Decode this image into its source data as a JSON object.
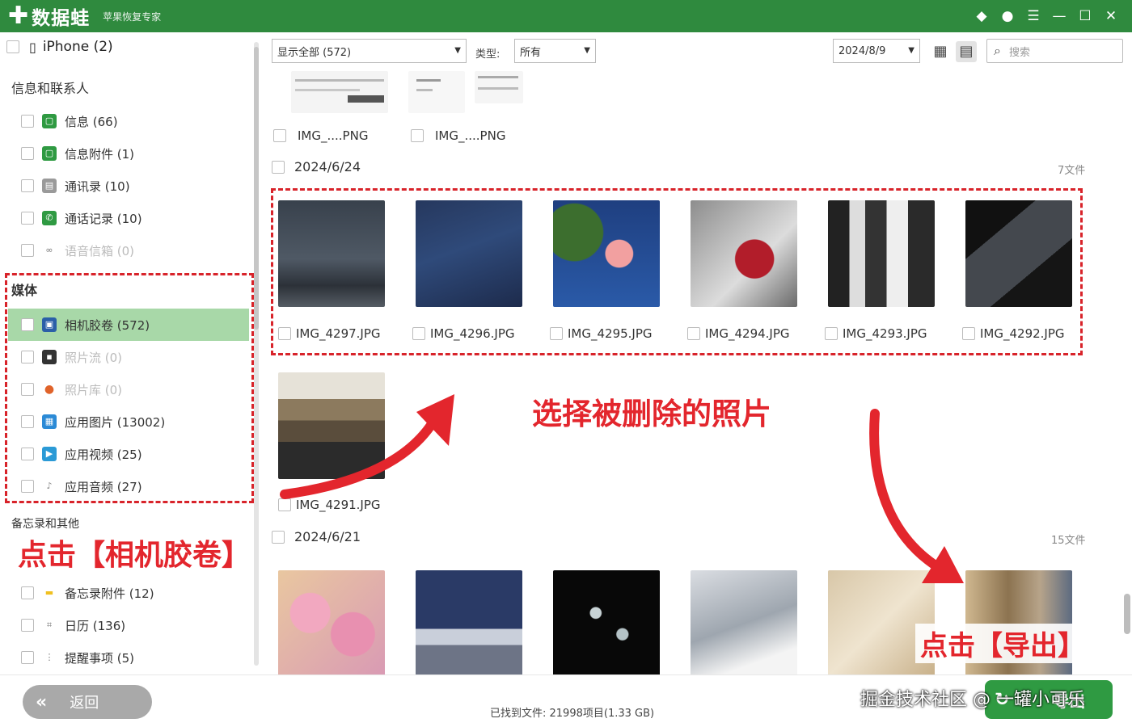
{
  "app": {
    "name": "数据蛙",
    "slogan": "苹果恢复专家"
  },
  "window_controls": [
    "gem-icon",
    "chat-icon",
    "menu-icon",
    "minimize-icon",
    "maximize-icon",
    "close-icon"
  ],
  "sidebar": {
    "device": "iPhone (2)",
    "sections": [
      {
        "title": "信息和联系人",
        "items": [
          {
            "label": "信息 (66)",
            "icon": "message-icon",
            "color": "#2f9a42"
          },
          {
            "label": "信息附件 (1)",
            "icon": "message-attachment-icon",
            "color": "#2f9a42"
          },
          {
            "label": "通讯录 (10)",
            "icon": "contacts-icon",
            "color": "#9a9a9a"
          },
          {
            "label": "通话记录 (10)",
            "icon": "phone-icon",
            "color": "#2f9a42"
          },
          {
            "label": "语音信箱 (0)",
            "icon": "voicemail-icon",
            "color": "#777777"
          }
        ]
      },
      {
        "title": "媒体",
        "items": [
          {
            "label": "相机胶卷 (572)",
            "icon": "camera-roll-icon",
            "color": "#2b5fa8",
            "selected": true
          },
          {
            "label": "照片流 (0)",
            "icon": "photo-stream-icon",
            "color": "#333333"
          },
          {
            "label": "照片库 (0)",
            "icon": "photo-library-icon",
            "color": "#e0632a"
          },
          {
            "label": "应用图片 (13002)",
            "icon": "app-photo-icon",
            "color": "#2b8ad6"
          },
          {
            "label": "应用视频 (25)",
            "icon": "app-video-icon",
            "color": "#2b9ad6"
          },
          {
            "label": "应用音频 (27)",
            "icon": "app-audio-icon",
            "color": "#888888"
          }
        ]
      },
      {
        "title": "备忘录和其他",
        "items": [
          {
            "label": "备忘录附件 (12)",
            "icon": "note-attachment-icon",
            "color": "#f0c020"
          },
          {
            "label": "日历 (136)",
            "icon": "calendar-icon",
            "color": "#777777"
          },
          {
            "label": "提醒事项 (5)",
            "icon": "reminder-icon",
            "color": "#777777"
          }
        ]
      }
    ]
  },
  "toolbar": {
    "filter_select": "显示全部 (572)",
    "type_label": "类型:",
    "type_select": "所有",
    "date_select": "2024/8/9",
    "search_placeholder": "搜索"
  },
  "top_captions": [
    "IMG_....PNG",
    "IMG_....PNG"
  ],
  "groups": [
    {
      "date": "2024/6/24",
      "count": "7文件",
      "photos": [
        {
          "name": "IMG_4297.JPG"
        },
        {
          "name": "IMG_4296.JPG"
        },
        {
          "name": "IMG_4295.JPG"
        },
        {
          "name": "IMG_4294.JPG"
        },
        {
          "name": "IMG_4293.JPG"
        },
        {
          "name": "IMG_4292.JPG"
        },
        {
          "name": "IMG_4291.JPG"
        }
      ]
    },
    {
      "date": "2024/6/21",
      "count": "15文件",
      "photos": []
    }
  ],
  "annotations": {
    "select_photos": "选择被删除的照片",
    "click_camera_roll": "点击【相机胶卷】",
    "click_export": "点击【导出】"
  },
  "bottom": {
    "back_label": "返回",
    "status": "已找到文件: 21998项目(1.33 GB)",
    "export_label": "导出",
    "watermark": "掘金技术社区 @ 一罐小可乐"
  },
  "colors": {
    "brand_green": "#2f8a3e",
    "annotation_red": "#d8232a",
    "selected_row": "#a8d8a8"
  }
}
